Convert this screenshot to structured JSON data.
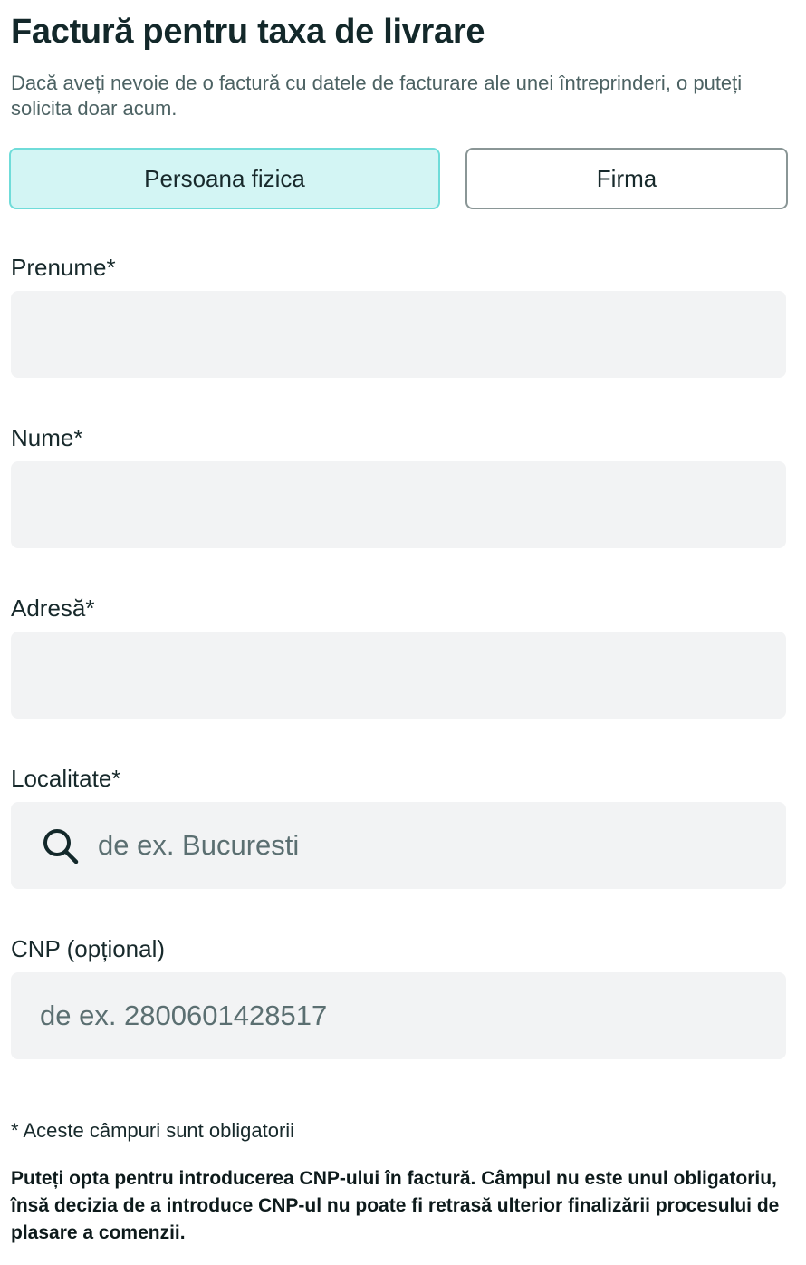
{
  "header": {
    "title": "Factură pentru taxa de livrare",
    "subtitle": "Dacă aveți nevoie de o factură cu datele de facturare ale unei întreprinderi, o puteți solicita doar acum."
  },
  "toggle": {
    "selected": "Persoana fizica",
    "options": [
      "Persoana fizica",
      "Firma"
    ]
  },
  "form": {
    "first_name": {
      "label": "Prenume*",
      "value": "",
      "placeholder": ""
    },
    "last_name": {
      "label": "Nume*",
      "value": "",
      "placeholder": ""
    },
    "address": {
      "label": "Adresă*",
      "value": "",
      "placeholder": ""
    },
    "locality": {
      "label": "Localitate*",
      "value": "",
      "placeholder": "de ex. Bucuresti",
      "icon": "search-icon"
    },
    "cnp": {
      "label": "CNP (opțional)",
      "value": "",
      "placeholder": "de ex. 2800601428517"
    }
  },
  "footer": {
    "required_note": "* Aceste câmpuri sunt obligatorii",
    "cnp_note": "Puteți opta pentru introducerea CNP-ului în factură. Câmpul nu este unul obligatoriu, însă decizia de a introduce CNP-ul nu poate fi retrasă ulterior finalizării procesului de plasare a comenzii."
  },
  "colors": {
    "title": "#13282a",
    "subtitle": "#4c6263",
    "toggle_active_bg": "#d3f5f4",
    "toggle_active_border": "#6fdcd9",
    "toggle_inactive_border": "#8a9696",
    "field_bg": "#f2f3f4"
  }
}
